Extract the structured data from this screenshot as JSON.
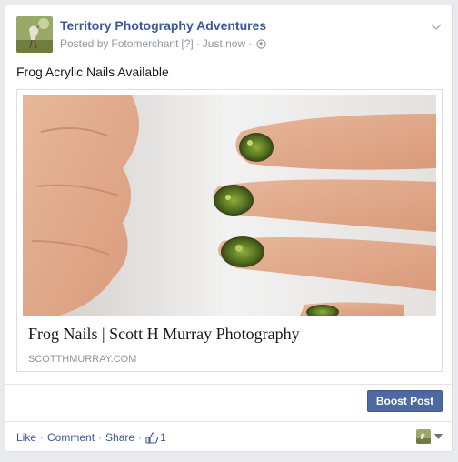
{
  "post": {
    "page_name": "Territory Photography Adventures",
    "posted_by_prefix": "Posted by",
    "posted_by": "Fotomerchant",
    "help_marker": "[?]",
    "separator": "·",
    "time": "Just now",
    "privacy_icon": "globe-icon",
    "options_icon": "chevron-down-icon",
    "message": "Frog Acrylic Nails Available"
  },
  "link": {
    "image_alt": "Hand with frog-pattern nail art",
    "title": "Frog Nails | Scott H Murray Photography",
    "domain": "SCOTTHMURRAY.COM"
  },
  "boost": {
    "label": "Boost Post",
    "color": "#4e69a2"
  },
  "actions": {
    "like": "Like",
    "comment": "Comment",
    "share": "Share",
    "separator": "·",
    "like_icon": "thumbs-up-icon",
    "like_count": "1"
  },
  "colors": {
    "link_blue": "#3b5998",
    "meta_gray": "#9197a3",
    "background": "#e9eaed"
  }
}
